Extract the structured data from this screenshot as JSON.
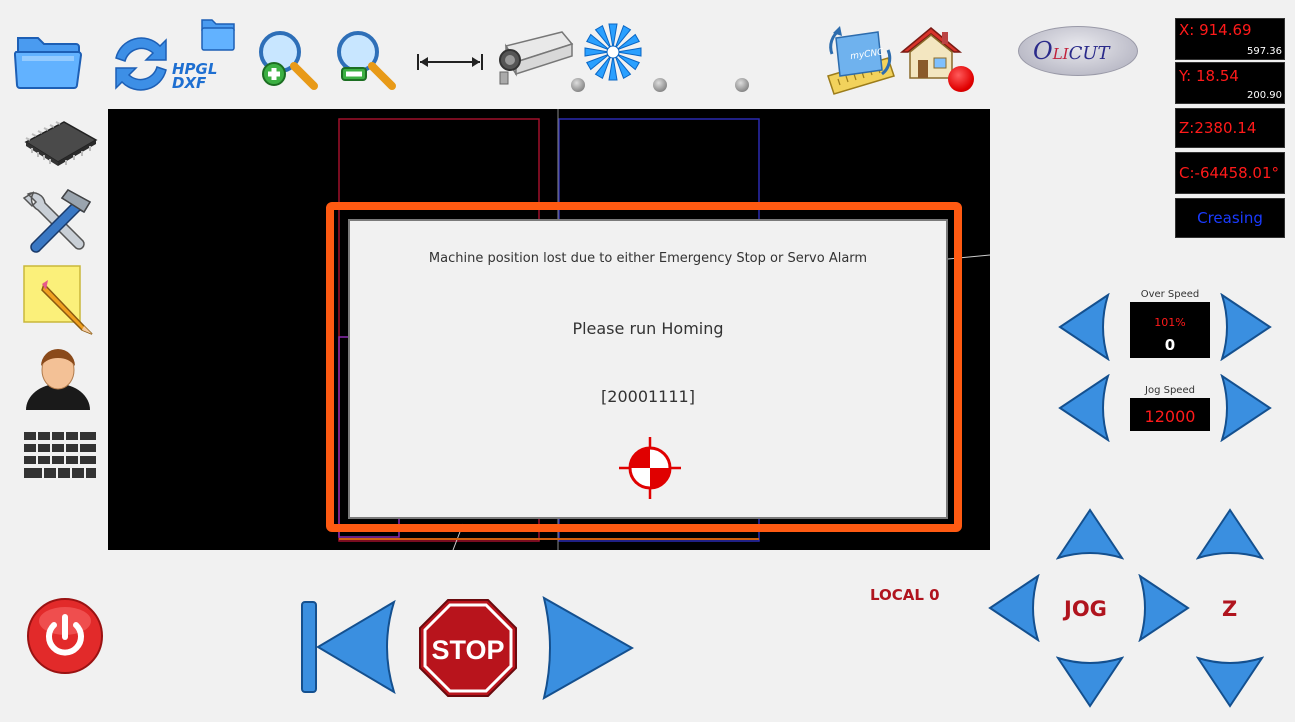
{
  "toolbar": {
    "items": [
      {
        "name": "open-folder",
        "icon": "folder-icon"
      },
      {
        "name": "import-hpgl-dxf",
        "icon": "refresh-folder-icon",
        "label_line1": "HPGL",
        "label_line2": "DXF"
      },
      {
        "name": "zoom-in",
        "icon": "zoom-in-icon"
      },
      {
        "name": "zoom-out",
        "icon": "zoom-out-icon"
      },
      {
        "name": "measure",
        "icon": "measure-arrow-icon"
      },
      {
        "name": "camera",
        "icon": "camera-icon"
      },
      {
        "name": "spindle",
        "icon": "spindle-icon"
      },
      {
        "name": "mycnc",
        "icon": "mycnc-ruler-icon",
        "label": "myCNC"
      },
      {
        "name": "home",
        "icon": "home-icon"
      }
    ]
  },
  "logo": {
    "text_left": "O",
    "text_mid": "LI",
    "text_right": "CUT"
  },
  "coords": {
    "x": {
      "main": "X: 914.69",
      "sub": "597.36"
    },
    "y": {
      "main": "Y: 18.54",
      "sub": "200.90"
    },
    "z": {
      "main": "Z:2380.14"
    },
    "c": {
      "main": "C:-64458.01°"
    },
    "mode": "Creasing"
  },
  "dialog": {
    "message": "Machine position lost due to either Emergency Stop or Servo Alarm",
    "instruction": "Please run Homing",
    "code": "[20001111]",
    "icon": "homing-target-icon"
  },
  "speeds": {
    "over_label": "Over Speed",
    "over_percent": "101%",
    "over_value": "0",
    "jog_label": "Jog Speed",
    "jog_value": "12000"
  },
  "jog": {
    "label": "JOG",
    "z_label": "Z",
    "local": "LOCAL 0"
  },
  "controls": {
    "stop_label": "STOP"
  },
  "colors": {
    "accent_red": "#ff1a1a",
    "dialog_border": "#ff5a12",
    "arrow_blue": "#2f8fe0",
    "jog_text": "#b0141e",
    "mode_text": "#1a3bff"
  }
}
